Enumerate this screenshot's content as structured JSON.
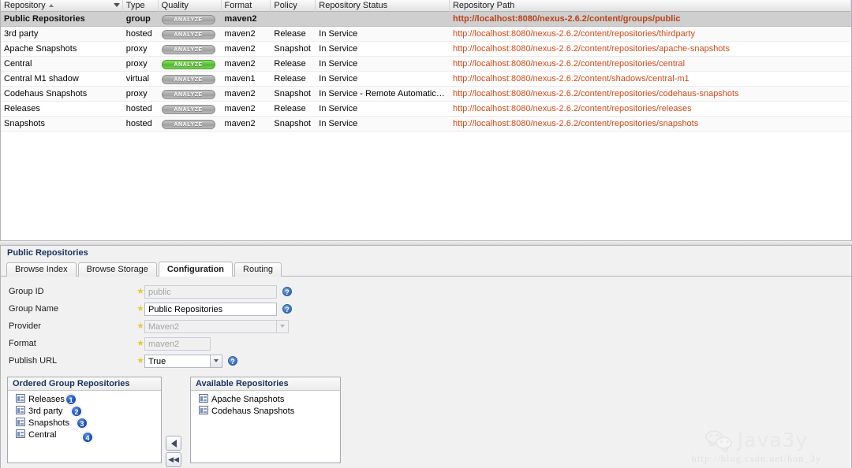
{
  "grid": {
    "columns": [
      {
        "key": "repository",
        "label": "Repository",
        "sorted": "asc"
      },
      {
        "key": "type",
        "label": "Type"
      },
      {
        "key": "quality",
        "label": "Quality"
      },
      {
        "key": "format",
        "label": "Format"
      },
      {
        "key": "policy",
        "label": "Policy"
      },
      {
        "key": "status",
        "label": "Repository Status"
      },
      {
        "key": "path",
        "label": "Repository Path"
      }
    ],
    "quality_button_label": "ANALYZE",
    "rows": [
      {
        "repository": "Public Repositories",
        "type": "group",
        "quality": "ANALYZE",
        "quality_state": "gray",
        "format": "maven2",
        "policy": "",
        "status": "",
        "path": "http://localhost:8080/nexus-2.6.2/content/groups/public",
        "selected": true
      },
      {
        "repository": "3rd party",
        "type": "hosted",
        "quality": "ANALYZE",
        "quality_state": "gray",
        "format": "maven2",
        "policy": "Release",
        "status": "In Service",
        "path": "http://localhost:8080/nexus-2.6.2/content/repositories/thirdparty",
        "selected": false
      },
      {
        "repository": "Apache Snapshots",
        "type": "proxy",
        "quality": "ANALYZE",
        "quality_state": "gray",
        "format": "maven2",
        "policy": "Snapshot",
        "status": "In Service",
        "path": "http://localhost:8080/nexus-2.6.2/content/repositories/apache-snapshots",
        "selected": false
      },
      {
        "repository": "Central",
        "type": "proxy",
        "quality": "ANALYZE",
        "quality_state": "green",
        "format": "maven2",
        "policy": "Release",
        "status": "In Service",
        "path": "http://localhost:8080/nexus-2.6.2/content/repositories/central",
        "selected": false
      },
      {
        "repository": "Central M1 shadow",
        "type": "virtual",
        "quality": "ANALYZE",
        "quality_state": "gray",
        "format": "maven1",
        "policy": "Release",
        "status": "In Service",
        "path": "http://localhost:8080/nexus-2.6.2/content/shadows/central-m1",
        "selected": false
      },
      {
        "repository": "Codehaus Snapshots",
        "type": "proxy",
        "quality": "ANALYZE",
        "quality_state": "gray",
        "format": "maven2",
        "policy": "Snapshot",
        "status": "In Service - Remote Automaticall...",
        "path": "http://localhost:8080/nexus-2.6.2/content/repositories/codehaus-snapshots",
        "selected": false
      },
      {
        "repository": "Releases",
        "type": "hosted",
        "quality": "ANALYZE",
        "quality_state": "gray",
        "format": "maven2",
        "policy": "Release",
        "status": "In Service",
        "path": "http://localhost:8080/nexus-2.6.2/content/repositories/releases",
        "selected": false
      },
      {
        "repository": "Snapshots",
        "type": "hosted",
        "quality": "ANALYZE",
        "quality_state": "gray",
        "format": "maven2",
        "policy": "Snapshot",
        "status": "In Service",
        "path": "http://localhost:8080/nexus-2.6.2/content/repositories/snapshots",
        "selected": false
      }
    ]
  },
  "detail": {
    "title": "Public Repositories",
    "tabs": [
      {
        "label": "Browse Index",
        "active": false
      },
      {
        "label": "Browse Storage",
        "active": false
      },
      {
        "label": "Configuration",
        "active": true
      },
      {
        "label": "Routing",
        "active": false
      }
    ],
    "fields": [
      {
        "label": "Group ID",
        "value": "public",
        "required": true,
        "disabled": true,
        "widget": "text",
        "width": "wide",
        "help": true
      },
      {
        "label": "Group Name",
        "value": "Public Repositories",
        "required": true,
        "disabled": false,
        "widget": "text",
        "width": "wide",
        "help": true
      },
      {
        "label": "Provider",
        "value": "Maven2",
        "required": true,
        "disabled": true,
        "widget": "select",
        "width": "wide",
        "help": false
      },
      {
        "label": "Format",
        "value": "maven2",
        "required": true,
        "disabled": true,
        "widget": "text",
        "width": "narrow",
        "help": false
      },
      {
        "label": "Publish URL",
        "value": "True",
        "required": true,
        "disabled": false,
        "widget": "select",
        "width": "narrow",
        "help": true
      }
    ],
    "ordered_group": {
      "title": "Ordered Group Repositories",
      "items": [
        {
          "label": "Releases",
          "order": "1"
        },
        {
          "label": "3rd party",
          "order": "2"
        },
        {
          "label": "Snapshots",
          "order": "3"
        },
        {
          "label": "Central",
          "order": "4"
        }
      ]
    },
    "available": {
      "title": "Available Repositories",
      "items": [
        {
          "label": "Apache Snapshots"
        },
        {
          "label": "Codehaus Snapshots"
        }
      ]
    },
    "transfer": {
      "move_left_label": "◀",
      "move_all_left_label": "◀◀"
    }
  },
  "watermark": {
    "brand": "Java3y",
    "url": "http://blog.csdn.net/hon_3y"
  },
  "colors": {
    "accent_link": "#cf4b1c",
    "quality_green": "#5cbf3a",
    "quality_gray": "#aaaaaa",
    "header_text": "#17335c",
    "badge_blue": "#1f4fae",
    "selected_row": "#cfcfcf"
  }
}
